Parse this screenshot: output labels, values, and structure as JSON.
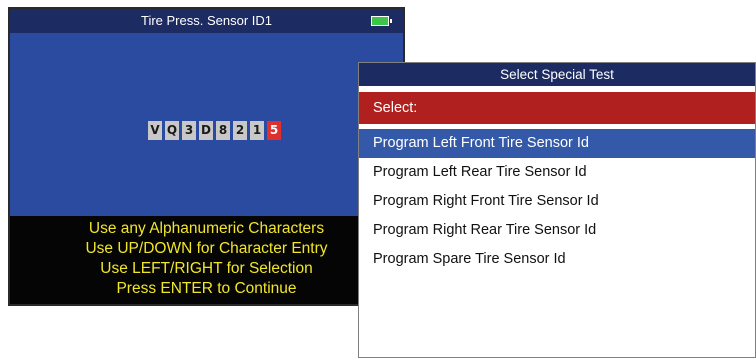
{
  "sensor_screen": {
    "title": "Tire Press. Sensor ID1",
    "battery_icon": "battery-full-icon",
    "characters": [
      "V",
      "Q",
      "3",
      "D",
      "8",
      "2",
      "1",
      "5"
    ],
    "active_index": 7,
    "instructions": [
      "Use any Alphanumeric Characters",
      "Use UP/DOWN for Character Entry",
      "Use LEFT/RIGHT for Selection",
      "Press ENTER to Continue"
    ]
  },
  "special_test": {
    "title": "Select Special Test",
    "select_label": "Select:",
    "selected_index": 0,
    "items": [
      "Program Left Front Tire Sensor Id",
      "Program Left Rear Tire Sensor Id",
      "Program Right Front Tire Sensor Id",
      "Program Right Rear Tire Sensor Id",
      "Program Spare Tire Sensor Id"
    ]
  },
  "colors": {
    "screen_blue": "#2b4ba0",
    "title_bar_navy": "#1d2b63",
    "select_red": "#b0201e",
    "highlight_blue": "#3459a8",
    "instruction_yellow": "#f2e628",
    "active_char_red": "#e0302e",
    "battery_green": "#3ec64a"
  }
}
